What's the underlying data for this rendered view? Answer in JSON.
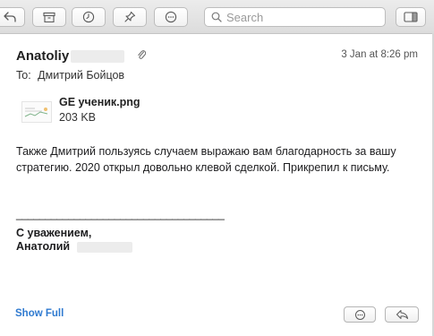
{
  "toolbar": {
    "buttons": [
      {
        "name": "reply-back-icon"
      },
      {
        "name": "archive-icon"
      },
      {
        "name": "clock-icon"
      },
      {
        "name": "pin-icon"
      },
      {
        "name": "more-icon"
      }
    ],
    "search_placeholder": "Search",
    "sidebar_toggle_icon": "sidebar-icon"
  },
  "message": {
    "sender_name": "Anatoliy",
    "date": "3 Jan at 8:26 pm",
    "to_label": "To:",
    "to_name": "Дмитрий Бойцов",
    "attachment": {
      "name": "GE ученик.png",
      "size": "203 KB"
    },
    "body": "Также Дмитрий пользуясь случаем выражаю вам благодарность за вашу стратегию. 2020 открыл довольно клевой сделкой. Прикрепил к письму.",
    "signature_line": "____________________________________",
    "signature_greeting": "С уважением,",
    "signature_name": "Анатолий"
  },
  "footer": {
    "show_full_label": "Show Full"
  },
  "colors": {
    "accent": "#2f7ad0",
    "redaction": "#ececec"
  }
}
